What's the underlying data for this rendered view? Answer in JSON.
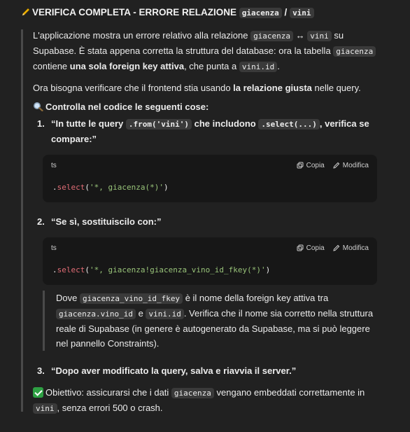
{
  "title": {
    "emoji": "✏️",
    "text": "VERIFICA COMPLETA - ERRORE RELAZIONE",
    "code1": "giacenza",
    "sep": "/",
    "code2": "vini"
  },
  "p1": {
    "t1": "L'applicazione mostra un errore relativo alla relazione",
    "c1": "giacenza",
    "arrow": "↔",
    "c2": "vini",
    "t2": "su Supabase. È stata appena corretta la struttura del database: ora la tabella",
    "c3": "giacenza",
    "t3": "contiene",
    "b1": "una sola foreign key attiva",
    "t4": ", che punta a",
    "c4": "vini.id",
    "t5": "."
  },
  "p2": {
    "t1": "Ora bisogna verificare che il frontend stia usando",
    "b1": "la relazione giusta",
    "t2": "nelle query."
  },
  "section_heading": "Controlla nel codice le seguenti cose:",
  "items": [
    {
      "num": "1.",
      "t1": "“In tutte le query",
      "c1": ".from('vini')",
      "t2": "che includono",
      "c2": ".select(...)",
      "t3": ", verifica se compare:”"
    },
    {
      "num": "2.",
      "text": "“Se sì, sostituiscilo con:”"
    },
    {
      "num": "3.",
      "text": "“Dopo aver modificato la query, salva e riavvia il server.”"
    }
  ],
  "code_blocks": [
    {
      "lang": "ts",
      "copy_label": "Copia",
      "edit_label": "Modifica",
      "dot": ".",
      "fn": "select",
      "open": "(",
      "str": "'*, giacenza(*)'",
      "close": ")"
    },
    {
      "lang": "ts",
      "copy_label": "Copia",
      "edit_label": "Modifica",
      "dot": ".",
      "fn": "select",
      "open": "(",
      "str": "'*, giacenza!giacenza_vino_id_fkey(*)'",
      "close": ")"
    }
  ],
  "note": {
    "t1": "Dove",
    "c1": "giacenza_vino_id_fkey",
    "t2": "è il nome della foreign key attiva tra",
    "c2": "giacenza.vino_id",
    "t3": "e",
    "c3": "vini.id",
    "t4": ". Verifica che il nome sia corretto nella struttura reale di Supabase (in genere è autogenerato da Supabase, ma si può leggere nel pannello Constraints)."
  },
  "goal": {
    "t1": "Obiettivo: assicurarsi che i dati",
    "c1": "giacenza",
    "t2": "vengano embeddati correttamente in",
    "c2": "vini",
    "t3": ", senza errori 500 o crash."
  }
}
